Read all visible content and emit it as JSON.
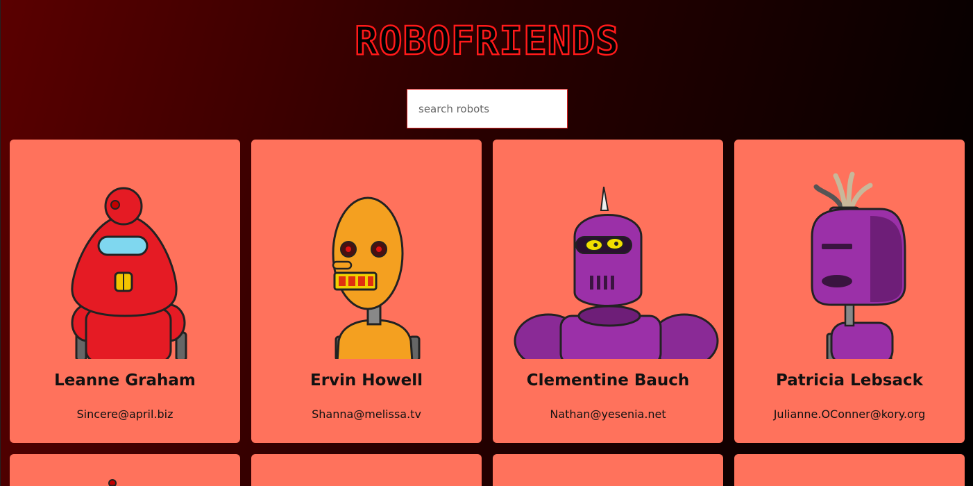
{
  "header": {
    "title": "ROBOFRIENDS"
  },
  "search": {
    "placeholder": "search robots",
    "value": ""
  },
  "colors": {
    "card_background": "#ff725c",
    "title_stroke": "#ff1a1a",
    "search_border": "#e02020"
  },
  "robots": [
    {
      "name": "Leanne Graham",
      "email": "Sincere@april.biz",
      "avatar": "red-robot-icon"
    },
    {
      "name": "Ervin Howell",
      "email": "Shanna@melissa.tv",
      "avatar": "orange-robot-icon"
    },
    {
      "name": "Clementine Bauch",
      "email": "Nathan@yesenia.net",
      "avatar": "purple-robot-icon"
    },
    {
      "name": "Patricia Lebsack",
      "email": "Julianne.OConner@kory.org",
      "avatar": "purple-robot-icon"
    }
  ]
}
